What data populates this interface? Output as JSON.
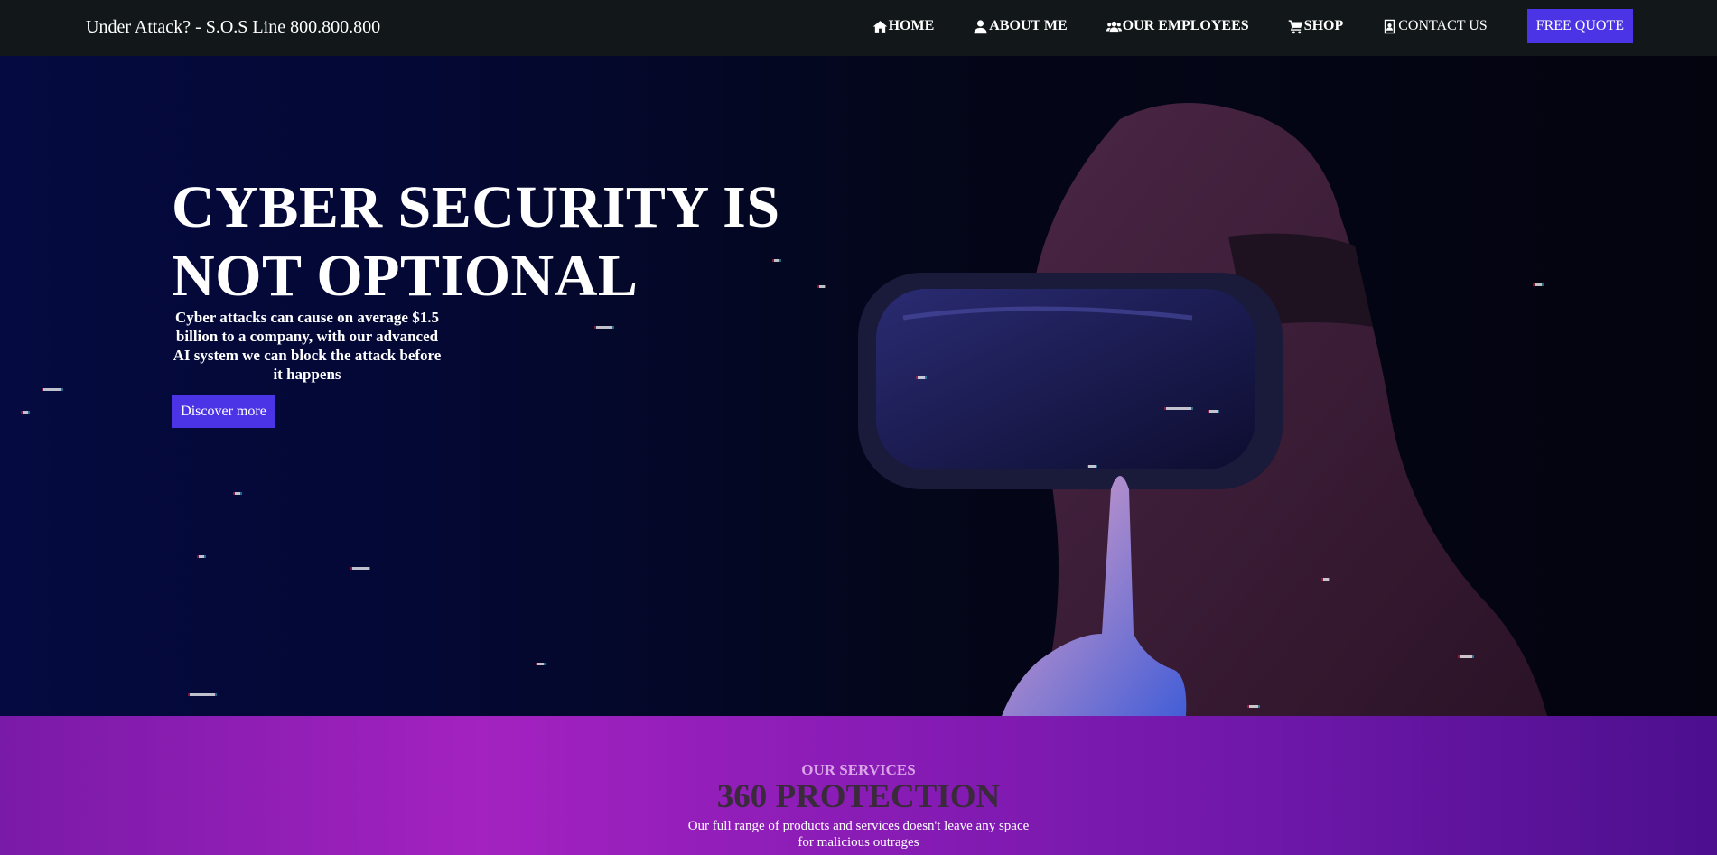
{
  "topbar": {
    "hotline": "Under Attack? - S.O.S Line 800.800.800",
    "nav": [
      {
        "label": "HOME",
        "icon": "home-icon"
      },
      {
        "label": "ABOUT ME",
        "icon": "user-icon"
      },
      {
        "label": "OUR EMPLOYEES",
        "icon": "users-icon"
      },
      {
        "label": "SHOP",
        "icon": "cart-icon"
      },
      {
        "label": "CONTACT US",
        "icon": "contact-card-icon"
      }
    ],
    "quote_label": "FREE QUOTE"
  },
  "hero": {
    "title_line1": "CYBER SECURITY IS",
    "title_line2": "NOT OPTIONAL",
    "subtitle": "Cyber attacks can cause on average $1.5 billion to a company, with our advanced AI system we can block the attack before it happens",
    "cta_label": "Discover more",
    "image": "hooded-person-vr-headset"
  },
  "services": {
    "eyebrow": "OUR SERVICES",
    "heading": "360 PROTECTION",
    "description": "Our full range of products and services doesn't leave any space for malicious outrages"
  },
  "colors": {
    "topbar_bg": "#121719",
    "accent": "#4a34e6",
    "hero_bg": "#040722",
    "services_bg": "#a322c0"
  }
}
